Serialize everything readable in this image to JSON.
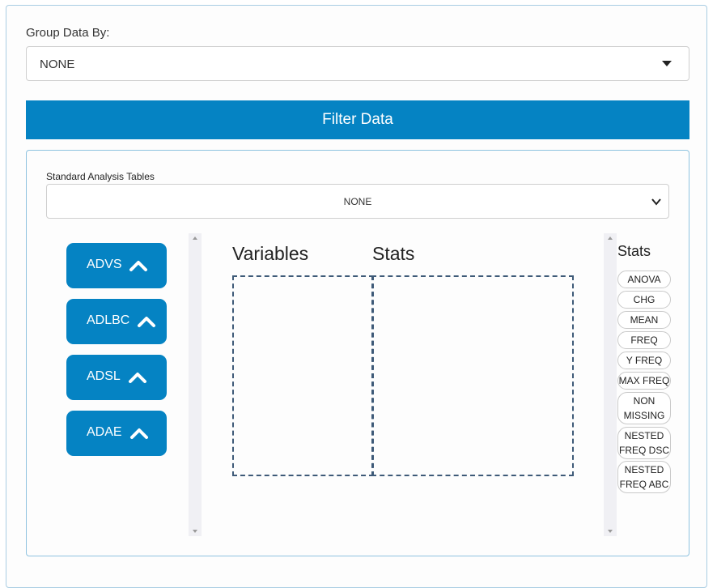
{
  "group_by": {
    "label": "Group Data By:",
    "value": "NONE"
  },
  "filter_button": "Filter Data",
  "analysis_tables": {
    "label": "Standard Analysis Tables",
    "value": "NONE"
  },
  "datasets": [
    {
      "label": "ADVS"
    },
    {
      "label": "ADLBC"
    },
    {
      "label": "ADSL"
    },
    {
      "label": "ADAE"
    }
  ],
  "table_builder": {
    "variables_label": "Variables",
    "stats_label": "Stats"
  },
  "stats_panel": {
    "title": "Stats",
    "items": [
      "ANOVA",
      "CHG",
      "MEAN",
      "FREQ",
      "Y FREQ",
      "MAX FREQ",
      "NON\nMISSING",
      "NESTED\nFREQ DSC",
      "NESTED\nFREQ ABC"
    ]
  },
  "colors": {
    "accent": "#0583c3",
    "border": "#8fc3e0",
    "dashed": "#3e5a78"
  }
}
